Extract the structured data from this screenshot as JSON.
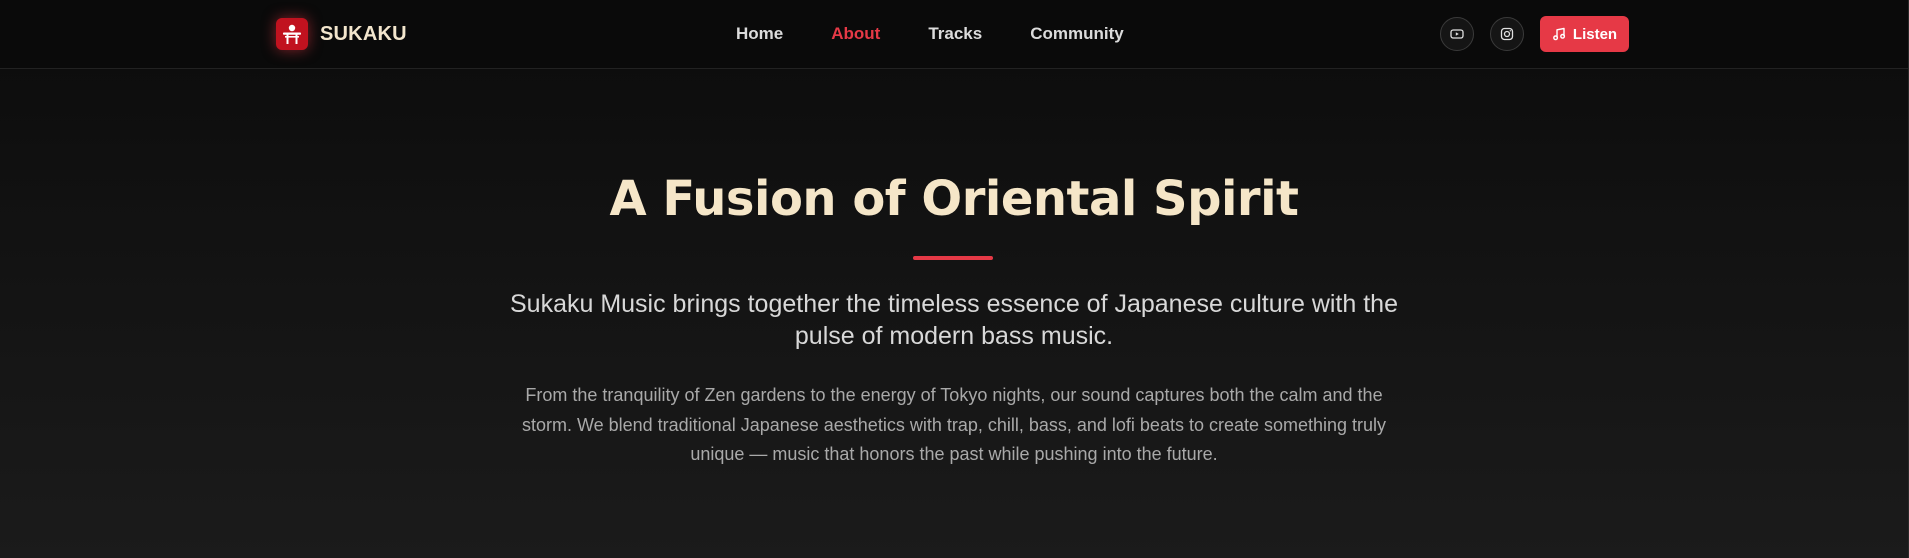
{
  "navbar": {
    "brand": {
      "name": "SUKAKU",
      "logo_icon": "torii-gate-icon"
    },
    "links": [
      {
        "label": "Home",
        "active": false
      },
      {
        "label": "About",
        "active": true
      },
      {
        "label": "Tracks",
        "active": false
      },
      {
        "label": "Community",
        "active": false
      }
    ],
    "social": [
      {
        "icon": "youtube-icon"
      },
      {
        "icon": "instagram-icon"
      }
    ],
    "listen_button": {
      "label": "Listen",
      "icon": "music-note-icon"
    }
  },
  "hero": {
    "title": "A Fusion of Oriental Spirit",
    "lead": "Sukaku Music brings together the timeless essence of Japanese culture with the pulse of modern bass music.",
    "body": "From the tranquility of Zen gardens to the energy of Tokyo nights, our sound captures both the calm and the storm. We blend traditional Japanese aesthetics with trap, chill, bass, and lofi beats to create something truly unique — music that honors the past while pushing into the future."
  },
  "colors": {
    "accent": "#e63946",
    "title": "#f5e6c8",
    "brand_text": "#f3e6cd",
    "background": "#111111",
    "nav_text": "#dcdcdc",
    "body_text": "#a9a9a9"
  }
}
